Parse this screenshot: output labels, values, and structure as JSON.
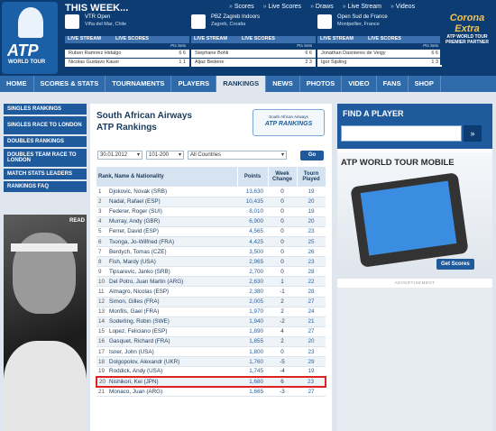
{
  "header": {
    "logo_text": "ATP",
    "logo_sub": "WORLD TOUR",
    "this_week": "THIS WEEK...",
    "top_links": [
      "Scores",
      "Live Scores",
      "Draws",
      "Live Stream",
      "Videos"
    ],
    "tournaments": [
      {
        "name": "VTR Open",
        "location": "Viña del Mar, Chile",
        "live_stream": "LIVE STREAM",
        "live_scores": "LIVE SCORES",
        "pts_sets": "Pts   Sets",
        "rows": [
          {
            "player": "Ruben Ramirez Hidalgo",
            "score": "6   6"
          },
          {
            "player": "Nicolas Gustavo Kauer",
            "score": "1   1"
          }
        ]
      },
      {
        "name": "PBZ Zagreb Indoors",
        "location": "Zagreb, Croatia",
        "live_stream": "LIVE STREAM",
        "live_scores": "LIVE SCORES",
        "pts_sets": "Pts   Sets",
        "rows": [
          {
            "player": "Stephane Bohli",
            "score": "6   6"
          },
          {
            "player": "Aljaz Bedene",
            "score": "2   3"
          }
        ]
      },
      {
        "name": "Open Sud de France",
        "location": "Montpellier, France",
        "live_stream": "LIVE STREAM",
        "live_scores": "LIVE SCORES",
        "pts_sets": "Pts   Sets",
        "rows": [
          {
            "player": "Jonathan Dasnieres de Veigy",
            "score": "6   6"
          },
          {
            "player": "Igor Sijsling",
            "score": "1   3"
          }
        ]
      }
    ],
    "sponsor": "Corona Extra",
    "sponsor_sub": "ATP WORLD TOUR PREMIER PARTNER"
  },
  "nav": [
    "HOME",
    "SCORES & STATS",
    "TOURNAMENTS",
    "PLAYERS",
    "RANKINGS",
    "NEWS",
    "PHOTOS",
    "VIDEO",
    "FANS",
    "SHOP"
  ],
  "nav_active": "RANKINGS",
  "sidebar": [
    "SINGLES RANKINGS",
    "SINGLES RACE TO LONDON",
    "DOUBLES RANKINGS",
    "DOUBLES TEAM RACE TO LONDON",
    "MATCH STATS LEADERS",
    "RANKINGS FAQ"
  ],
  "sidebar_photo_label": "READ",
  "main": {
    "title_line1": "South African Airways",
    "title_line2": "ATP Rankings",
    "logo_airline": "South African Airways",
    "logo_text": "ATP RANKINGS",
    "date": "30.01.2012",
    "range": "101-200",
    "country": "All Countries",
    "go": "Go",
    "columns": [
      "Rank, Name & Nationality",
      "Points",
      "Week Change",
      "Tourn Played"
    ],
    "rows": [
      {
        "rank": "1",
        "name": "Djokovic, Novak (SRB)",
        "points": "13,630",
        "change": "0",
        "played": "19"
      },
      {
        "rank": "2",
        "name": "Nadal, Rafael (ESP)",
        "points": "10,435",
        "change": "0",
        "played": "20"
      },
      {
        "rank": "3",
        "name": "Federer, Roger (SUI)",
        "points": "8,010",
        "change": "0",
        "played": "19"
      },
      {
        "rank": "4",
        "name": "Murray, Andy (GBR)",
        "points": "6,900",
        "change": "0",
        "played": "20"
      },
      {
        "rank": "5",
        "name": "Ferrer, David (ESP)",
        "points": "4,565",
        "change": "0",
        "played": "23"
      },
      {
        "rank": "6",
        "name": "Tsonga, Jo-Wilfried (FRA)",
        "points": "4,425",
        "change": "0",
        "played": "25"
      },
      {
        "rank": "7",
        "name": "Berdych, Tomas (CZE)",
        "points": "3,500",
        "change": "0",
        "played": "26"
      },
      {
        "rank": "8",
        "name": "Fish, Mardy (USA)",
        "points": "2,965",
        "change": "0",
        "played": "23"
      },
      {
        "rank": "9",
        "name": "Tipsarevic, Janko (SRB)",
        "points": "2,700",
        "change": "0",
        "played": "28"
      },
      {
        "rank": "10",
        "name": "Del Potro, Juan Martin (ARG)",
        "points": "2,630",
        "change": "1",
        "played": "22"
      },
      {
        "rank": "11",
        "name": "Almagro, Nicolas (ESP)",
        "points": "2,380",
        "change": "-1",
        "played": "28"
      },
      {
        "rank": "12",
        "name": "Simon, Gilles (FRA)",
        "points": "2,005",
        "change": "2",
        "played": "27"
      },
      {
        "rank": "13",
        "name": "Monfils, Gael (FRA)",
        "points": "1,970",
        "change": "2",
        "played": "24"
      },
      {
        "rank": "14",
        "name": "Soderling, Robin (SWE)",
        "points": "1,940",
        "change": "-2",
        "played": "21"
      },
      {
        "rank": "15",
        "name": "Lopez, Feliciano (ESP)",
        "points": "1,890",
        "change": "4",
        "played": "27"
      },
      {
        "rank": "16",
        "name": "Gasquet, Richard (FRA)",
        "points": "1,855",
        "change": "2",
        "played": "20"
      },
      {
        "rank": "17",
        "name": "Isner, John (USA)",
        "points": "1,800",
        "change": "0",
        "played": "23"
      },
      {
        "rank": "18",
        "name": "Dolgopolov, Alexandr (UKR)",
        "points": "1,760",
        "change": "-5",
        "played": "29"
      },
      {
        "rank": "19",
        "name": "Roddick, Andy (USA)",
        "points": "1,745",
        "change": "-4",
        "played": "19"
      },
      {
        "rank": "20",
        "name": "Nishikori, Kei (JPN)",
        "points": "1,680",
        "change": "6",
        "played": "23"
      },
      {
        "rank": "21",
        "name": "Monaco, Juan (ARG)",
        "points": "1,665",
        "change": "-3",
        "played": "27"
      }
    ],
    "highlight_rank": "20"
  },
  "right": {
    "find_title": "FIND A PLAYER",
    "mobile_title": "ATP WORLD TOUR MOBILE",
    "get_scores": "Get Scores",
    "advertisement": "ADVERTISEMENT"
  },
  "colors": {
    "header_bg": "#0d3c73",
    "nav_bg": "#2f6aab",
    "accent": "#1f5b9c",
    "highlight": "#dd2222"
  }
}
